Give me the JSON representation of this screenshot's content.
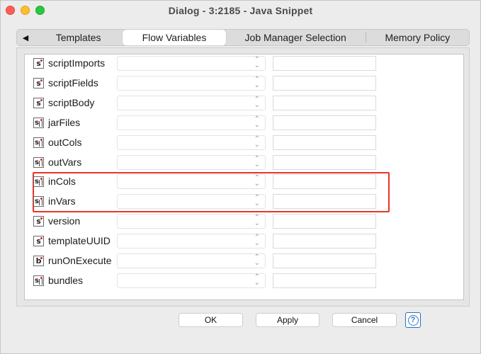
{
  "window": {
    "title": "Dialog - 3:2185 - Java Snippet"
  },
  "tabs": [
    {
      "label": "Templates"
    },
    {
      "label": "Flow Variables",
      "selected": true
    },
    {
      "label": "Job Manager Selection"
    },
    {
      "label": "Memory Policy"
    }
  ],
  "tab_scroll_icon": "◀",
  "variables": [
    {
      "name": "scriptImports",
      "icon": "string-variable-icon",
      "icon_text": "s"
    },
    {
      "name": "scriptFields",
      "icon": "string-variable-icon",
      "icon_text": "s"
    },
    {
      "name": "scriptBody",
      "icon": "string-variable-icon",
      "icon_text": "s"
    },
    {
      "name": "jarFiles",
      "icon": "string-array-variable-icon",
      "icon_text": "s"
    },
    {
      "name": "outCols",
      "icon": "string-array-variable-icon",
      "icon_text": "s"
    },
    {
      "name": "outVars",
      "icon": "string-array-variable-icon",
      "icon_text": "s"
    },
    {
      "name": "inCols",
      "icon": "string-array-variable-icon",
      "icon_text": "s"
    },
    {
      "name": "inVars",
      "icon": "string-array-variable-icon",
      "icon_text": "s"
    },
    {
      "name": "version",
      "icon": "string-variable-icon",
      "icon_text": "s"
    },
    {
      "name": "templateUUID",
      "icon": "string-variable-icon",
      "icon_text": "s"
    },
    {
      "name": "runOnExecute",
      "icon": "boolean-variable-icon",
      "icon_text": "b"
    },
    {
      "name": "bundles",
      "icon": "string-array-variable-icon",
      "icon_text": "s"
    }
  ],
  "highlight_color": "#e8332c",
  "buttons": {
    "ok": "OK",
    "apply": "Apply",
    "cancel": "Cancel",
    "help": "?"
  }
}
